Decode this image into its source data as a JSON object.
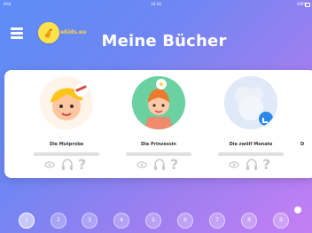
{
  "status": {
    "left": "iPad",
    "time": "10:18",
    "right": "100%"
  },
  "header": {
    "logo_text": "eKids.eu",
    "title": "Meine Bücher"
  },
  "books": [
    {
      "title": "Die Mutprobe"
    },
    {
      "title": "Die Prinzessin"
    },
    {
      "title": "Die zwölf Monate"
    },
    {
      "title": "D"
    }
  ],
  "icons": {
    "eye": "eye-icon",
    "headphones": "headphones-icon",
    "question": "question-icon"
  },
  "pager": {
    "pages": [
      "1",
      "2",
      "3",
      "4",
      "5",
      "6",
      "7",
      "8",
      "9"
    ],
    "active_index": 0
  },
  "colors": {
    "bg_start": "#5d8df7",
    "bg_end": "#c47ff4",
    "white": "#ffffff"
  }
}
